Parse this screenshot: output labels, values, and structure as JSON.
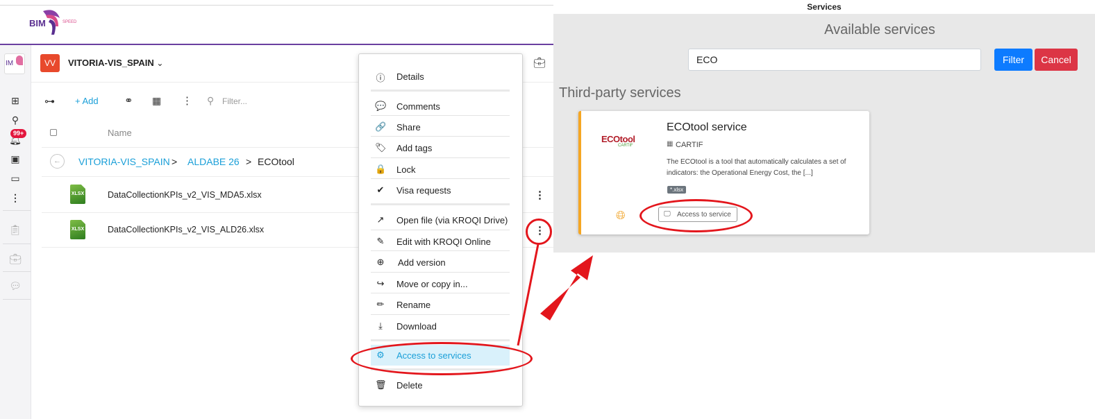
{
  "app": {
    "logo_text": "BIM",
    "logo_sub": "SPEED",
    "rail_logo": "IM",
    "notification_badge": "99+",
    "project": {
      "avatar": "VV",
      "name": "VITORIA-VIS_SPAIN",
      "chevron": "⌄"
    }
  },
  "toolbar": {
    "add_label": "+ Add",
    "filter_placeholder": "Filter..."
  },
  "table": {
    "column_name": "Name",
    "breadcrumb": [
      {
        "label": "VITORIA-VIS_SPAIN",
        "link": true
      },
      {
        "label": ">",
        "link": false
      },
      {
        "label": "ALDABE 26",
        "link": true
      },
      {
        "label": ">",
        "link": false
      },
      {
        "label": "ECOtool",
        "link": false
      }
    ],
    "rows": [
      {
        "icon_text": "XLSX",
        "name": "DataCollectionKPIs_v2_VIS_MDA5.xlsx"
      },
      {
        "icon_text": "XLSX",
        "name": "DataCollectionKPIs_v2_VIS_ALD26.xlsx"
      }
    ]
  },
  "context_menu": {
    "items": [
      {
        "icon": "info-icon",
        "glyph": "ⓘ",
        "label": "Details"
      },
      {
        "icon": "comment-icon",
        "glyph": "💬",
        "label": "Comments"
      },
      {
        "icon": "share-icon",
        "glyph": "🔗",
        "label": "Share"
      },
      {
        "icon": "tag-icon",
        "glyph": "🏷",
        "label": "Add tags"
      },
      {
        "icon": "lock-icon",
        "glyph": "🔒",
        "label": "Lock"
      },
      {
        "icon": "check-circle-icon",
        "glyph": "✔",
        "label": "Visa requests"
      },
      {
        "icon": "external-link-icon",
        "glyph": "↗",
        "label": "Open file (via KROQI Drive)"
      },
      {
        "icon": "edit-doc-icon",
        "glyph": "✎",
        "label": "Edit with KROQI Online"
      },
      {
        "icon": "add-version-icon",
        "glyph": "⊕",
        "label": "Add version"
      },
      {
        "icon": "move-icon",
        "glyph": "↪",
        "label": "Move or copy in..."
      },
      {
        "icon": "pencil-icon",
        "glyph": "✏",
        "label": "Rename"
      },
      {
        "icon": "download-icon",
        "glyph": "⤓",
        "label": "Download"
      },
      {
        "icon": "services-icon",
        "glyph": "⚙",
        "label": "Access to services"
      },
      {
        "icon": "trash-icon",
        "glyph": "🗑",
        "label": "Delete"
      }
    ]
  },
  "services": {
    "window_title": "Services",
    "heading": "Available services",
    "search_value": "ECO",
    "filter_label": "Filter",
    "cancel_label": "Cancel",
    "section_title": "Third-party services",
    "card": {
      "logo_text": "ECOtool",
      "logo_sub": "CARTIF",
      "title": "ECOtool service",
      "org": "CARTIF",
      "description": "The ECOtool is a tool that automatically calculates a set of indicators: the Operational Energy Cost, the [...]",
      "tag": "*.xlsx",
      "access_label": "Access to service"
    }
  },
  "colors": {
    "brand_purple": "#6a3fa0",
    "link_blue": "#1a9fd8",
    "annotation_red": "#e3161c",
    "filter_blue": "#0d7bff",
    "cancel_red": "#dc3545",
    "card_accent": "#f5a623"
  }
}
